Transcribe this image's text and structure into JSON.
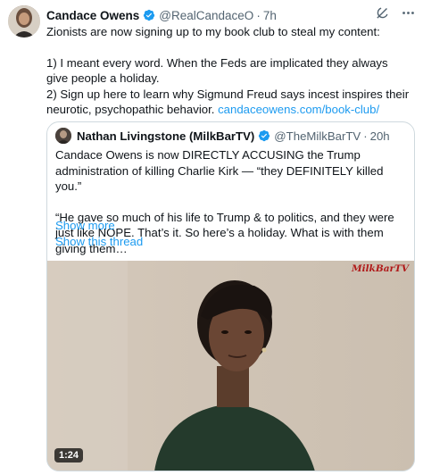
{
  "tweet": {
    "author_name": "Candace Owens",
    "handle": "@RealCandaceO",
    "separator": "·",
    "time": "7h",
    "lines": [
      "Zionists are now signing up to my book club to steal my content:",
      "1) I meant every word. When the Feds are implicated they always give people a holiday.",
      "2) Sign up here to learn why Sigmund Freud says incest inspires their neurotic, psychopathic behavior."
    ],
    "link": "candaceowens.com/book-club/"
  },
  "quote": {
    "author_name": "Nathan Livingstone (MilkBarTV)",
    "handle": "@TheMilkBarTV",
    "separator": "·",
    "time": "20h",
    "paragraph1": "Candace Owens is now DIRECTLY ACCUSING the Trump administration of killing Charlie Kirk — “they DEFINITELY killed you.”",
    "paragraph2": "“He gave so much of his life to Trump & to politics, and they were just like NOPE. That’s it. So here’s a holiday. What is with them giving them…",
    "show_more": "Show more",
    "show_thread": "Show this thread",
    "video": {
      "watermark": "MilkBarTV",
      "duration": "1:24"
    }
  },
  "icons": {
    "verified": "verified-badge-icon",
    "grok": "grok-icon",
    "more": "more-icon"
  },
  "colors": {
    "link": "#1d9bf0",
    "verified": "#1d9bf0",
    "secondary_text": "#536471",
    "watermark": "#b01a1a"
  }
}
